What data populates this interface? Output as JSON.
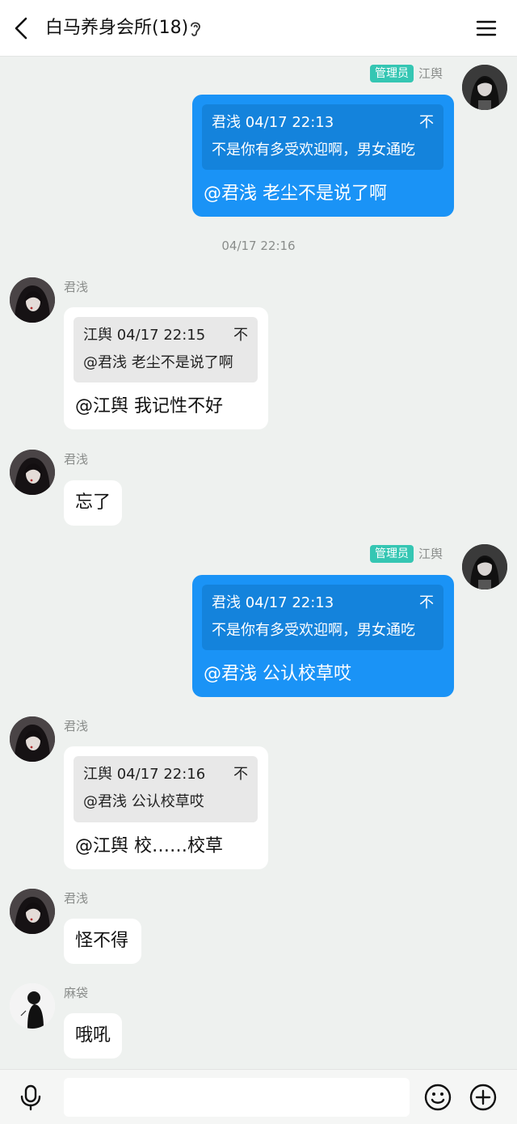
{
  "header": {
    "title": "白马养身会所(18)",
    "back_icon": "chevron-left-icon",
    "ear_icon": "ear-icon",
    "menu_icon": "hamburger-menu-icon"
  },
  "colors": {
    "outgoing_bubble": "#1a93f6",
    "incoming_bubble": "#ffffff",
    "admin_badge": "#35c6b3",
    "background": "#eef1ef"
  },
  "messages": [
    {
      "sender": "江舆",
      "badge": "管理员",
      "quote_head": "君浅 04/17 22:13",
      "quote_pin": "不",
      "quote_body": "不是你有多受欢迎啊，男女通吃",
      "text": "@君浅 老尘不是说了啊"
    },
    {
      "timestamp": "04/17 22:16"
    },
    {
      "sender": "君浅",
      "quote_head": "江舆 04/17 22:15",
      "quote_pin": "不",
      "quote_body": "@君浅 老尘不是说了啊",
      "text": "@江舆 我记性不好"
    },
    {
      "sender": "君浅",
      "text": "忘了"
    },
    {
      "sender": "江舆",
      "badge": "管理员",
      "quote_head": "君浅 04/17 22:13",
      "quote_pin": "不",
      "quote_body": "不是你有多受欢迎啊，男女通吃",
      "text": "@君浅 公认校草哎"
    },
    {
      "sender": "君浅",
      "quote_head": "江舆 04/17 22:16",
      "quote_pin": "不",
      "quote_body": "@君浅 公认校草哎",
      "text": "@江舆 校……校草"
    },
    {
      "sender": "君浅",
      "text": "怪不得"
    },
    {
      "sender": "麻袋",
      "text": "哦吼"
    }
  ],
  "footer": {
    "input_placeholder": "",
    "mic_icon": "microphone-icon",
    "emoji_icon": "emoji-icon",
    "plus_icon": "plus-circle-icon"
  }
}
